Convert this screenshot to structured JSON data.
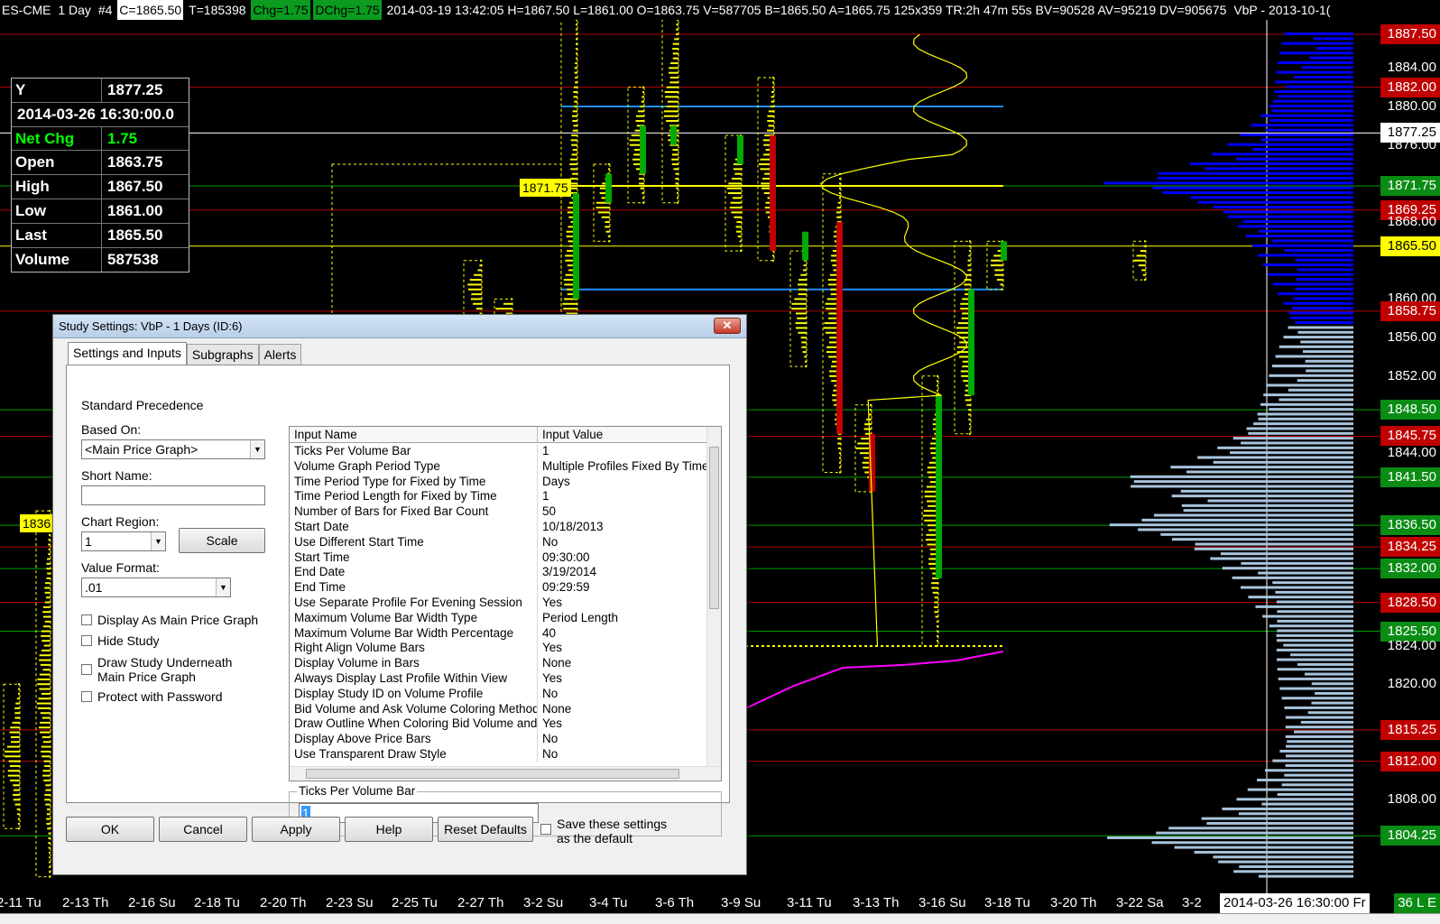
{
  "header": {
    "symbol": "ES-CME",
    "period": "1 Day",
    "chart_num": "#4",
    "close": "C=1865.50",
    "ticks": "T=185398",
    "chg": "Chg=1.75",
    "dchg": "DChg=1.75",
    "info": "2014-03-19 13:42:05 H=1867.50 L=1861.00 O=1863.75 V=587705 B=1865.50 A=1865.75 125x359 TR:2h 47m 55s BV=90528 AV=95219 DV=905675",
    "study": "VbP - 2013-10-1("
  },
  "data_window": {
    "y_label": "Y",
    "y_value": "1877.25",
    "datetime": "2014-03-26  16:30:00.0",
    "net_chg_label": "Net Chg",
    "net_chg_value": "1.75",
    "open_label": "Open",
    "open_value": "1863.75",
    "high_label": "High",
    "high_value": "1867.50",
    "low_label": "Low",
    "low_value": "1861.00",
    "last_label": "Last",
    "last_value": "1865.50",
    "volume_label": "Volume",
    "volume_value": "587538"
  },
  "chart_tags": {
    "tag_1871": "1871.75",
    "tag_1836": "1836"
  },
  "price_scale": [
    {
      "price": 1887.5,
      "text": "1887.50",
      "style": "red"
    },
    {
      "price": 1884.0,
      "text": "1884.00",
      "style": "plain"
    },
    {
      "price": 1882.0,
      "text": "1882.00",
      "style": "red"
    },
    {
      "price": 1880.0,
      "text": "1880.00",
      "style": "plain"
    },
    {
      "price": 1877.25,
      "text": "1877.25",
      "style": "white"
    },
    {
      "price": 1876.0,
      "text": "1876.00",
      "style": "plain"
    },
    {
      "price": 1871.75,
      "text": "1871.75",
      "style": "green"
    },
    {
      "price": 1869.25,
      "text": "1869.25",
      "style": "red"
    },
    {
      "price": 1868.0,
      "text": "1868.00",
      "style": "plain"
    },
    {
      "price": 1865.5,
      "text": "1865.50",
      "style": "yellow"
    },
    {
      "price": 1860.0,
      "text": "1860.00",
      "style": "plain"
    },
    {
      "price": 1858.75,
      "text": "1858.75",
      "style": "red"
    },
    {
      "price": 1856.0,
      "text": "1856.00",
      "style": "plain"
    },
    {
      "price": 1852.0,
      "text": "1852.00",
      "style": "plain"
    },
    {
      "price": 1848.5,
      "text": "1848.50",
      "style": "green"
    },
    {
      "price": 1845.75,
      "text": "1845.75",
      "style": "red"
    },
    {
      "price": 1844.0,
      "text": "1844.00",
      "style": "plain"
    },
    {
      "price": 1841.5,
      "text": "1841.50",
      "style": "green"
    },
    {
      "price": 1836.5,
      "text": "1836.50",
      "style": "green"
    },
    {
      "price": 1834.25,
      "text": "1834.25",
      "style": "red"
    },
    {
      "price": 1832.0,
      "text": "1832.00",
      "style": "green"
    },
    {
      "price": 1828.5,
      "text": "1828.50",
      "style": "red"
    },
    {
      "price": 1825.5,
      "text": "1825.50",
      "style": "green"
    },
    {
      "price": 1824.0,
      "text": "1824.00",
      "style": "plain"
    },
    {
      "price": 1820.0,
      "text": "1820.00",
      "style": "plain"
    },
    {
      "price": 1815.25,
      "text": "1815.25",
      "style": "red"
    },
    {
      "price": 1812.0,
      "text": "1812.00",
      "style": "red"
    },
    {
      "price": 1808.0,
      "text": "1808.00",
      "style": "plain"
    },
    {
      "price": 1804.25,
      "text": "1804.25",
      "style": "green"
    }
  ],
  "time_axis": {
    "ticks": [
      "2-11 Tu",
      "2-13 Th",
      "2-16 Su",
      "2-18 Tu",
      "2-20 Th",
      "2-23 Su",
      "2-25 Tu",
      "2-27 Th",
      "3-2 Su",
      "3-4 Tu",
      "3-6 Th",
      "3-9 Su",
      "3-11 Tu",
      "3-13 Th",
      "3-16 Su",
      "3-18 Tu",
      "3-20 Th",
      "3-22 Sa",
      "3-2"
    ],
    "cursor_time": "2014-03-26  16:30:00  Fr",
    "badge": "36 L E"
  },
  "dialog": {
    "title": "Study Settings: VbP - 1 Days (ID:6)",
    "tabs": [
      "Settings and Inputs",
      "Subgraphs",
      "Alerts"
    ],
    "standard_precedence": "Standard Precedence",
    "based_on_label": "Based On:",
    "based_on_value": "<Main Price Graph>",
    "short_name_label": "Short Name:",
    "short_name_value": "",
    "chart_region_label": "Chart Region:",
    "chart_region_value": "1",
    "scale_button": "Scale",
    "value_format_label": "Value Format:",
    "value_format_value": ".01",
    "checkboxes": {
      "display_main": "Display As Main Price Graph",
      "hide_study": "Hide Study",
      "draw_underneath_1": "Draw Study Underneath",
      "draw_underneath_2": "Main Price Graph",
      "protect": "Protect with Password"
    },
    "grid_header": {
      "name": "Input Name",
      "value": "Input Value"
    },
    "inputs": [
      {
        "name": "Ticks Per Volume Bar",
        "value": "1"
      },
      {
        "name": "Volume Graph Period Type",
        "value": "Multiple Profiles Fixed By Time"
      },
      {
        "name": "Time Period Type for Fixed by Time",
        "value": "Days"
      },
      {
        "name": "Time Period Length for Fixed by Time",
        "value": "1"
      },
      {
        "name": "Number of Bars for Fixed Bar Count",
        "value": "50"
      },
      {
        "name": "Start Date",
        "value": "10/18/2013"
      },
      {
        "name": "Use Different Start Time",
        "value": "No"
      },
      {
        "name": "Start Time",
        "value": "09:30:00"
      },
      {
        "name": "End Date",
        "value": "3/19/2014"
      },
      {
        "name": "End Time",
        "value": "09:29:59"
      },
      {
        "name": "Use Separate Profile For Evening Session",
        "value": "Yes"
      },
      {
        "name": "Maximum Volume Bar Width Type",
        "value": "Period Length"
      },
      {
        "name": "Maximum Volume Bar Width Percentage",
        "value": "40"
      },
      {
        "name": "Right Align Volume Bars",
        "value": "Yes"
      },
      {
        "name": "Display Volume in Bars",
        "value": "None"
      },
      {
        "name": "Always Display Last Profile Within View",
        "value": "Yes"
      },
      {
        "name": "Display Study ID on Volume Profile",
        "value": "No"
      },
      {
        "name": "Bid Volume and Ask Volume Coloring Method",
        "value": "None"
      },
      {
        "name": "Draw Outline When Coloring Bid Volume and...",
        "value": "Yes"
      },
      {
        "name": "Display Above Price Bars",
        "value": "No"
      },
      {
        "name": "Use Transparent Draw Style",
        "value": "No"
      }
    ],
    "desc_title": "Ticks Per Volume Bar",
    "desc_value": "1",
    "buttons": {
      "ok": "OK",
      "cancel": "Cancel",
      "apply": "Apply",
      "help": "Help",
      "reset": "Reset Defaults"
    },
    "save_default_1": "Save these settings",
    "save_default_2": "as the default"
  },
  "colors": {
    "background": "#000000",
    "volume_profile": "#ffff00",
    "up_bar": "#00aa00",
    "down_bar": "#c00000",
    "right_profile_high": "#0000ff",
    "right_profile_low": "#a8c4dc",
    "vwap": "#ff00ff"
  }
}
